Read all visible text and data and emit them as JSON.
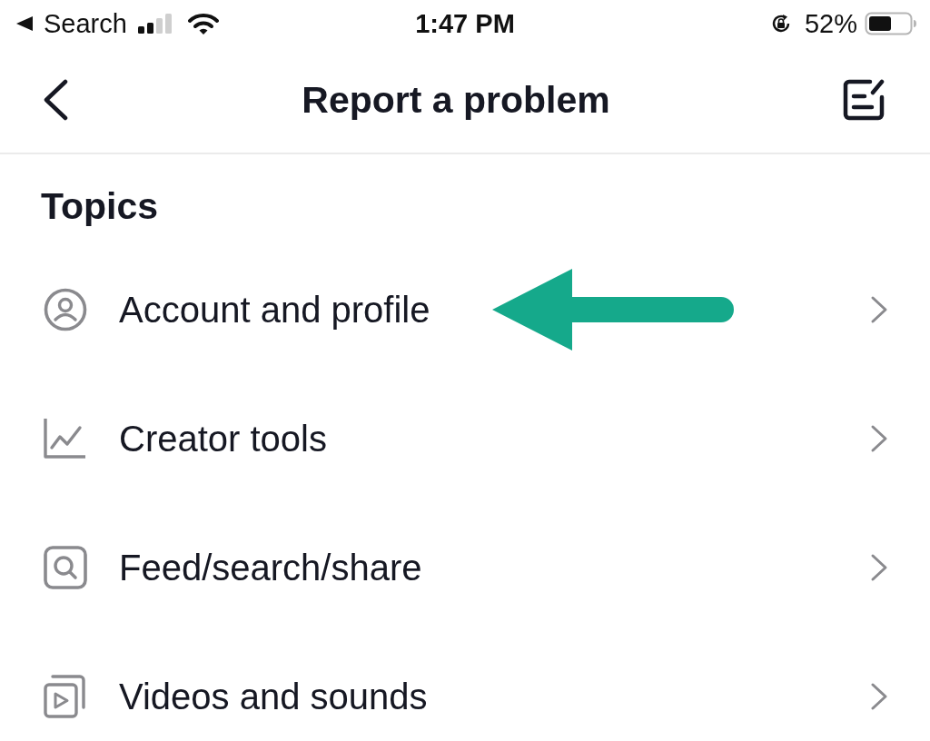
{
  "status_bar": {
    "back_label": "Search",
    "time": "1:47 PM",
    "battery": "52%"
  },
  "header": {
    "title": "Report a problem"
  },
  "section": {
    "title": "Topics"
  },
  "topics": [
    {
      "label": "Account and profile",
      "kind": "account",
      "annotated": true
    },
    {
      "label": "Creator tools",
      "kind": "chart",
      "annotated": false
    },
    {
      "label": "Feed/search/share",
      "kind": "search",
      "annotated": false
    },
    {
      "label": "Videos and sounds",
      "kind": "video",
      "annotated": false
    }
  ]
}
